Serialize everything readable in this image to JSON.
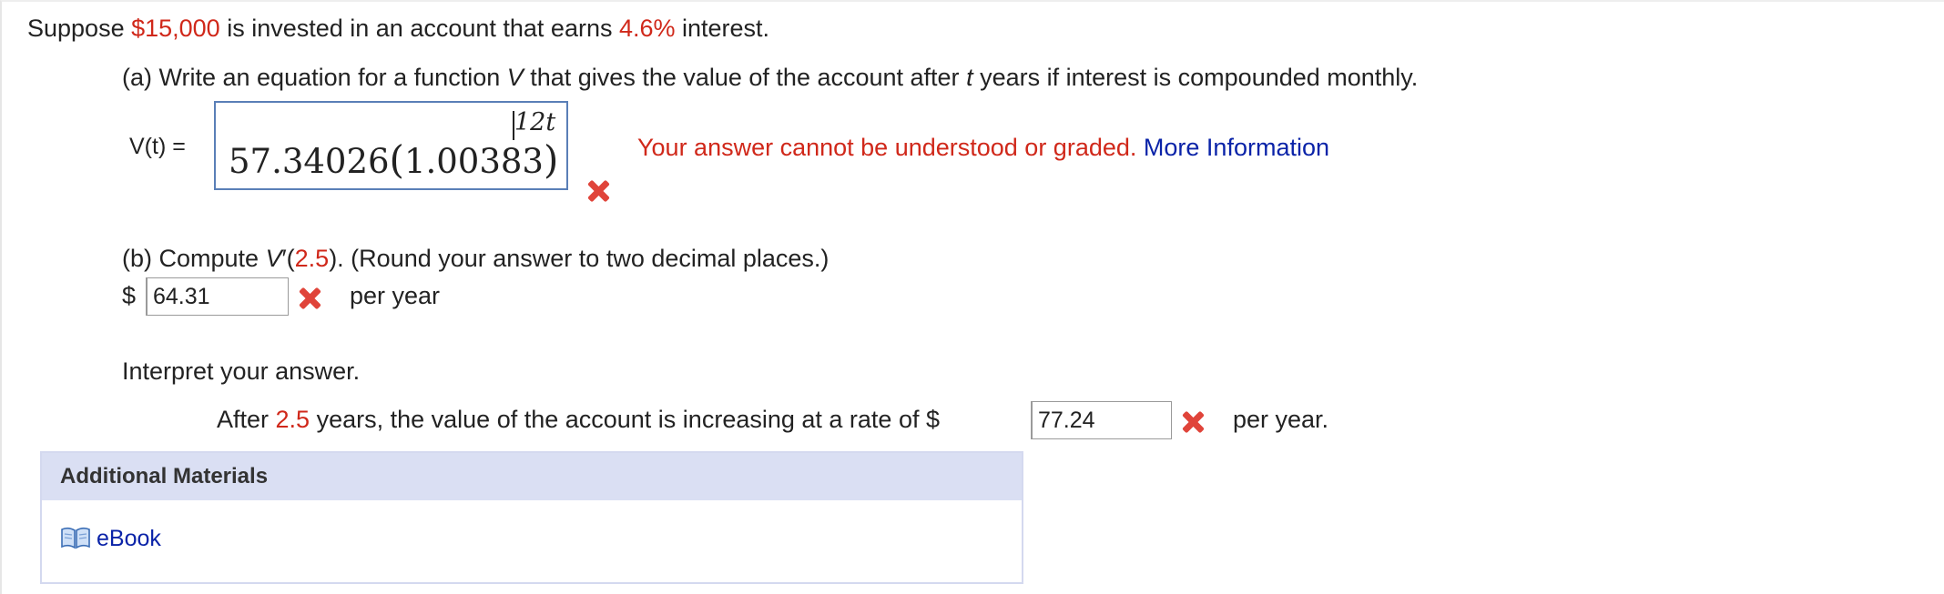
{
  "intro": {
    "prefix": "Suppose ",
    "amount": "$15,000",
    "middle": " is invested in an account that earns ",
    "rate": "4.6%",
    "suffix": " interest."
  },
  "part_a": {
    "prompt_pre": "(a) Write an equation for a function ",
    "var_v": "V",
    "prompt_mid": " that gives the value of the account after ",
    "var_t": "t",
    "prompt_post": " years if interest is compounded monthly.",
    "eq_label": "V(t) =",
    "answer_coefficient": "57.34026",
    "answer_base": "1.00383",
    "answer_exponent": "12t",
    "error_text": "Your answer cannot be understood or graded.",
    "more_info_link": "More Information"
  },
  "part_b": {
    "prompt_pre": "(b) Compute ",
    "func": "V",
    "prime_open": "′(",
    "value": "2.5",
    "prompt_post": "). (Round your answer to two decimal places.)",
    "currency": "$",
    "answer": "64.31",
    "unit": "per year"
  },
  "interpret": {
    "heading": "Interpret your answer.",
    "pre": "After ",
    "years": "2.5",
    "mid": " years, the value of the account is increasing at a rate of $",
    "answer": "77.24",
    "unit": "per year."
  },
  "additional_materials": {
    "header": "Additional Materials",
    "ebook_label": "eBook",
    "ebook_icon": "book-icon"
  },
  "colors": {
    "highlight_red": "#d0281a",
    "link_blue": "#0a23a8",
    "wrong_mark": "#e0443a",
    "panel_header": "#dadff3"
  }
}
